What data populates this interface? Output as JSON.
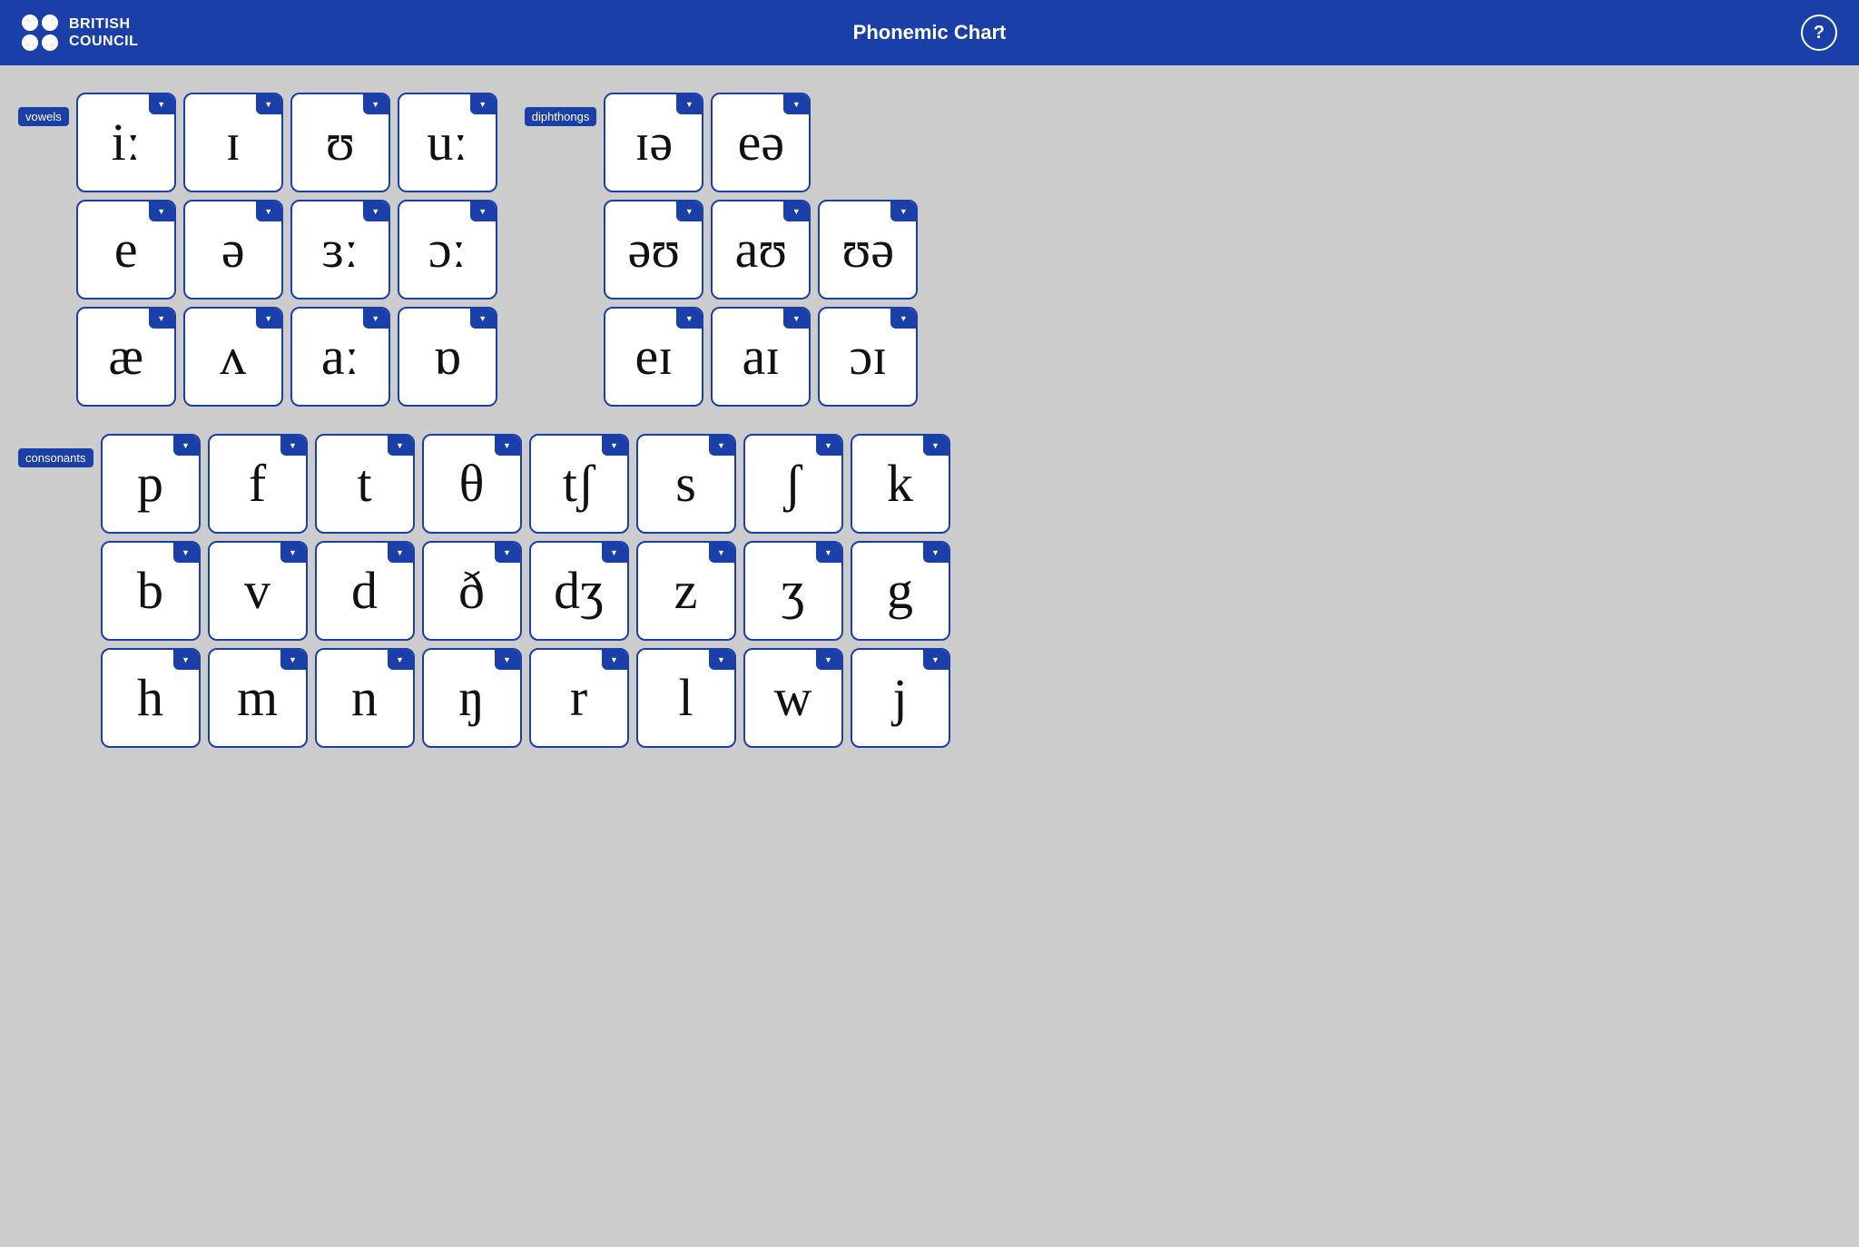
{
  "header": {
    "title": "Phonemic Chart",
    "logo_line1": "BRITISH",
    "logo_line2": "COUNCIL",
    "help_label": "?"
  },
  "sections": {
    "vowels_label": "vowels",
    "diphthongs_label": "diphthongs",
    "consonants_label": "consonants"
  },
  "vowels": [
    [
      "iː",
      "ɪ",
      "ʊ",
      "uː"
    ],
    [
      "e",
      "ə",
      "ɜː",
      "ɔː"
    ],
    [
      "æ",
      "ʌ",
      "aː",
      "ɒ"
    ]
  ],
  "diphthongs": [
    [
      "ɪə",
      "eə"
    ],
    [
      "əʊ",
      "aʊ",
      "ʊə"
    ],
    [
      "eɪ",
      "aɪ",
      "ɔɪ"
    ]
  ],
  "consonants": [
    [
      "p",
      "f",
      "t",
      "θ",
      "tʃ",
      "s",
      "ʃ",
      "k"
    ],
    [
      "b",
      "v",
      "d",
      "ð",
      "dʒ",
      "z",
      "ʒ",
      "g"
    ],
    [
      "h",
      "m",
      "n",
      "ŋ",
      "r",
      "l",
      "w",
      "j"
    ]
  ]
}
